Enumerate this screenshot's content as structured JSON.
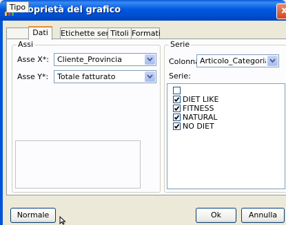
{
  "window": {
    "title": "Proprietà del grafico",
    "close": "x"
  },
  "tabs": [
    {
      "label": "Tipo"
    },
    {
      "label": "Dati"
    },
    {
      "label": "Etichette serie"
    },
    {
      "label": "Titoli"
    },
    {
      "label": "Formati"
    }
  ],
  "assi": {
    "legend": "Assi",
    "x_label": "Asse X*:",
    "x_value": "Cliente_Provincia",
    "y_label": "Asse Y*:",
    "y_value": "Totale fatturato"
  },
  "serie": {
    "legend": "Serie",
    "colonna_label": "Colonna:",
    "colonna_value": "Articolo_Categoria statis",
    "list_label": "Serie:",
    "items": [
      {
        "label": "",
        "checked": false
      },
      {
        "label": "DIET LIKE",
        "checked": true
      },
      {
        "label": "FITNESS",
        "checked": true
      },
      {
        "label": "NATURAL",
        "checked": true
      },
      {
        "label": "NO DIET",
        "checked": true
      }
    ]
  },
  "buttons": {
    "normale": "Normale",
    "ok": "Ok",
    "annulla": "Annulla"
  }
}
